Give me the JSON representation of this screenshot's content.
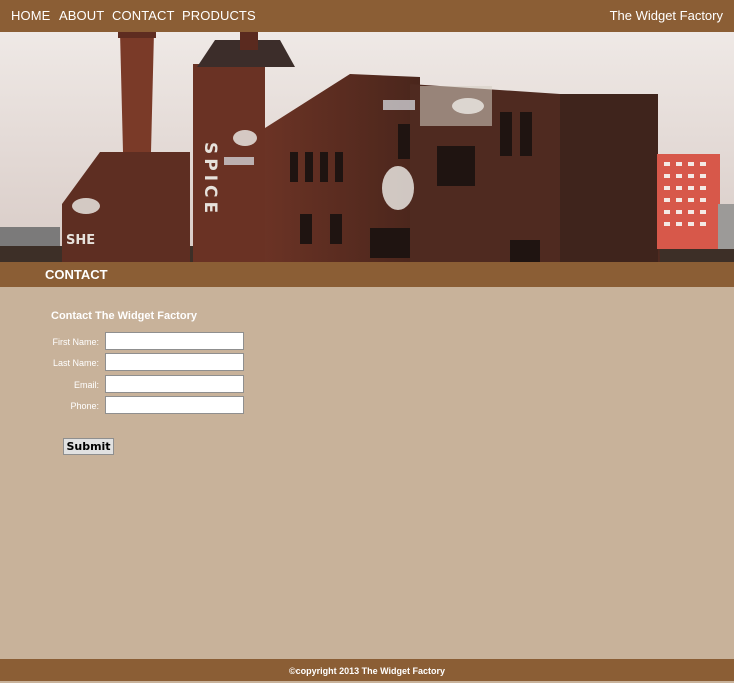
{
  "nav": {
    "items": [
      {
        "label": "HOME"
      },
      {
        "label": "ABOUT"
      },
      {
        "label": "CONTACT"
      },
      {
        "label": "PRODUCTS"
      }
    ],
    "brand": "The Widget Factory"
  },
  "hero": {
    "graffiti": [
      "SPICE",
      "SHE"
    ]
  },
  "section": {
    "title": "CONTACT"
  },
  "form": {
    "title": "Contact The Widget Factory",
    "fields": [
      {
        "label": "First Name:",
        "value": ""
      },
      {
        "label": "Last Name:",
        "value": ""
      },
      {
        "label": "Email:",
        "value": ""
      },
      {
        "label": "Phone:",
        "value": ""
      }
    ],
    "submit_label": "Submit"
  },
  "footer": {
    "copyright": "©copyright 2013 The Widget Factory"
  },
  "colors": {
    "nav_bg": "#8b5e35",
    "page_bg": "#c8b29a",
    "text_on_brown": "#ffffff"
  }
}
